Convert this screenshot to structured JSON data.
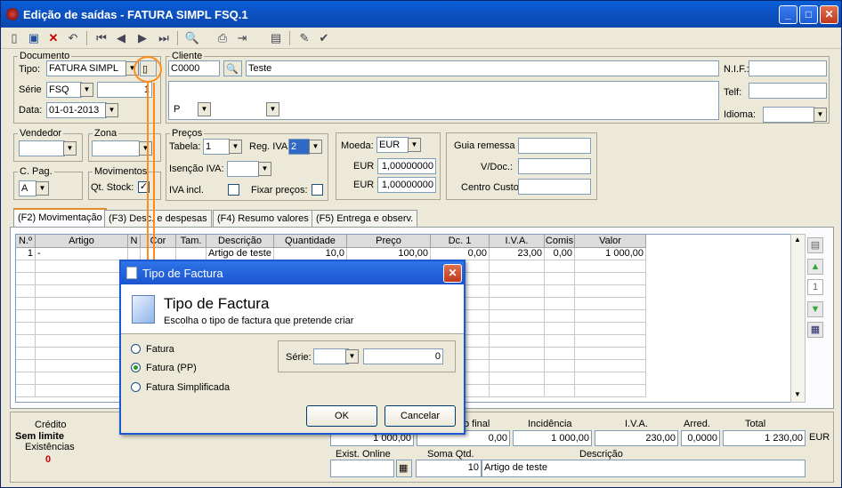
{
  "window": {
    "title": "Edição de saídas - FATURA SIMPL FSQ.1",
    "minimize": "_",
    "maximize": "□",
    "close": "✕"
  },
  "documento": {
    "legend": "Documento",
    "tipo_label": "Tipo:",
    "tipo_value": "FATURA SIMPL",
    "serie_label": "Série",
    "serie_value": "FSQ",
    "numero": "1",
    "data_label": "Data:",
    "data_value": "01-01-2013"
  },
  "cliente": {
    "legend": "Cliente",
    "codigo": "C0000",
    "nome": "Teste",
    "nif_label": "N.I.F.:",
    "telf_label": "Telf:",
    "idioma_label": "Idioma:",
    "p_value": "P"
  },
  "vendedor": {
    "legend": "Vendedor"
  },
  "zona": {
    "legend": "Zona"
  },
  "cpag": {
    "legend": "C. Pag.",
    "value": "A"
  },
  "movimentos": {
    "legend": "Movimentos",
    "qtstock_label": "Qt. Stock:"
  },
  "precos": {
    "legend": "Preços",
    "tabela_label": "Tabela:",
    "tabela_value": "1",
    "regiva_label": "Reg. IVA:",
    "regiva_value": "2",
    "isencao_label": "Isenção IVA:",
    "ivaincl_label": "IVA incl.",
    "fixar_label": "Fixar preços:"
  },
  "moeda": {
    "moeda_label": "Moeda:",
    "moeda_value": "EUR",
    "eur1_label": "EUR",
    "eur1_value": "1,00000000",
    "eur2_label": "EUR",
    "eur2_value": "1,00000000"
  },
  "guia": {
    "guia_label": "Guia remessa :",
    "vdoc_label": "V/Doc.:",
    "centro_label": "Centro Custo:"
  },
  "tabs": [
    "(F2) Movimentação",
    "(F3) Desc. e despesas",
    "(F4) Resumo valores",
    "(F5) Entrega e observ."
  ],
  "grid": {
    "headers": [
      "N.º",
      "Artigo",
      "N",
      "Cor",
      "Tam.",
      "Descrição",
      "Quantidade",
      "Preço",
      "Dc. 1",
      "I.V.A.",
      "Comis",
      "Valor"
    ],
    "rows": [
      [
        "1",
        "-",
        "",
        "",
        "",
        "Artigo de teste",
        "10,0",
        "100,00",
        "0,00",
        "23,00",
        "0,00",
        "1 000,00"
      ]
    ]
  },
  "side": {
    "counter": "1"
  },
  "bottom": {
    "credito_label": "Crédito",
    "credito_value": "Sem limite",
    "exist_label": "Existências",
    "exist_value": "0",
    "totais_headers": [
      "o final",
      "Incidência",
      "I.V.A.",
      "Arred.",
      "Total"
    ],
    "totais_values": [
      "1 000,00",
      "0,00",
      "1 000,00",
      "230,00",
      "0,0000",
      "1 230,00"
    ],
    "currency": "EUR",
    "exist_online_label": "Exist. Online",
    "soma_label": "Soma Qtd.",
    "desc_label": "Descrição",
    "soma_value": "10",
    "desc_value": "Artigo de teste"
  },
  "dialog": {
    "title": "Tipo de Factura",
    "heading": "Tipo de Factura",
    "subheading": "Escolha o tipo de factura que pretende criar",
    "options": [
      "Fatura",
      "Fatura (PP)",
      "Fatura Simplificada"
    ],
    "selected": 1,
    "serie_label": "Série:",
    "numero": "0",
    "ok": "OK",
    "cancel": "Cancelar"
  },
  "colors": {
    "highlight": "#ff8c1a",
    "titlebar": "#0a5fd8"
  }
}
